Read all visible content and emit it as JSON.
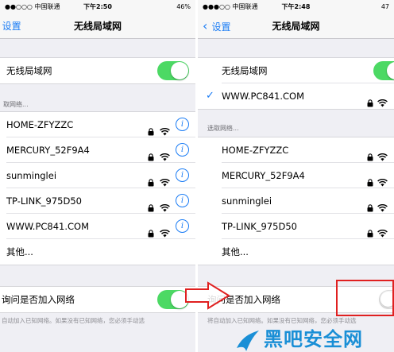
{
  "left": {
    "status": {
      "carrier": "●●○○○ 中国联通",
      "time": "下午2:50",
      "battery": "46%"
    },
    "nav": {
      "back": "设置",
      "title": "无线局域网"
    },
    "wifi_label": "无线局域网",
    "section_label": "取网络...",
    "networks": [
      "HOME-ZFYZZC",
      "MERCURY_52F9A4",
      "sunminglei",
      "TP-LINK_975D50",
      "WWW.PC841.COM"
    ],
    "other": "其他...",
    "ask_label": "询问是否加入网络",
    "footnote": "自动加入已知网络。如果没有已知网络，您必须手动选"
  },
  "right": {
    "status": {
      "carrier": "●●●○○ 中国联通",
      "time": "下午2:48",
      "battery": "47"
    },
    "nav": {
      "back": "设置",
      "title": "无线局域网"
    },
    "wifi_label": "无线局域网",
    "connected": "WWW.PC841.COM",
    "section_label": "选取网络...",
    "networks": [
      "HOME-ZFYZZC",
      "MERCURY_52F9A4",
      "sunminglei",
      "TP-LINK_975D50"
    ],
    "other": "其他...",
    "ask_label": "询问是否加入网络",
    "footnote": "将自动加入已知网络。如果没有已知网络，您必须手动选"
  },
  "watermark": "黑吧安全网",
  "colors": {
    "accent": "#1a7cf5",
    "toggle_on": "#4cd964",
    "highlight": "#e02020",
    "logo": "#1a8fd6"
  },
  "icons": [
    "lock-icon",
    "wifi-icon",
    "info-icon",
    "checkmark-icon",
    "back-chevron-icon",
    "arrow-right-icon",
    "bird-logo-icon"
  ]
}
